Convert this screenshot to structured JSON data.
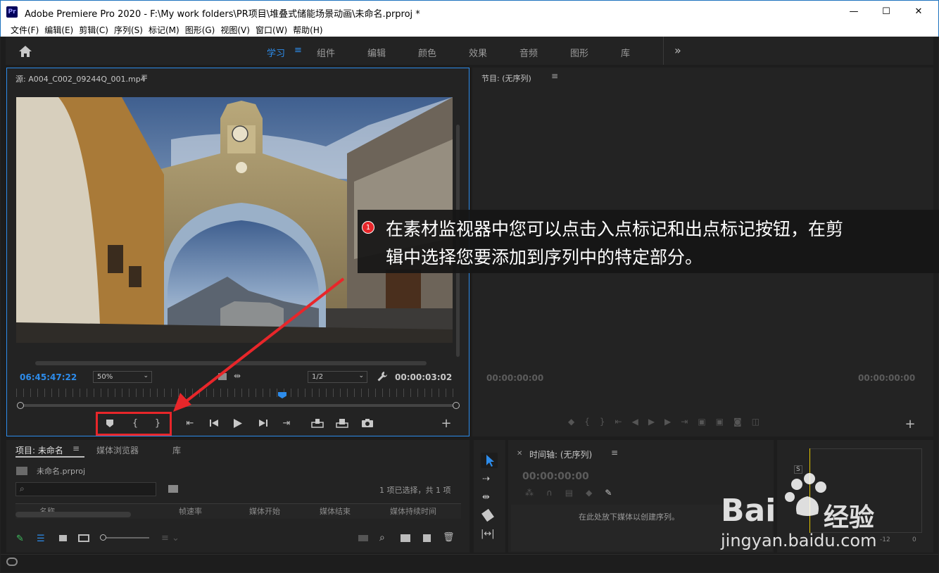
{
  "window": {
    "app_icon": "Pr",
    "title": "Adobe Premiere Pro 2020 - F:\\My work folders\\PR项目\\堆叠式储能场景动画\\未命名.prproj *",
    "min": "—",
    "max": "☐",
    "close": "✕"
  },
  "menu": [
    "文件(F)",
    "编辑(E)",
    "剪辑(C)",
    "序列(S)",
    "标记(M)",
    "图形(G)",
    "视图(V)",
    "窗口(W)",
    "帮助(H)"
  ],
  "workspaces": {
    "tabs": [
      "学习",
      "组件",
      "编辑",
      "颜色",
      "效果",
      "音频",
      "图形",
      "库"
    ],
    "active": "学习",
    "more": "»"
  },
  "source": {
    "title": "源: A004_C002_09244Q_001.mp4",
    "timecode": "06:45:47:22",
    "zoom": "50%",
    "resolution": "1/2",
    "duration": "00:00:03:02",
    "playhead_fraction": 0.6
  },
  "program": {
    "title": "节目: (无序列)",
    "timecode_left": "00:00:00:00",
    "timecode_right": "00:00:00:00"
  },
  "project": {
    "tabs": [
      "项目: 未命名",
      "媒体浏览器",
      "库"
    ],
    "file": "未命名.prproj",
    "selection": "1 项已选择，共 1 项",
    "columns": [
      "名称",
      "帧速率",
      "媒体开始",
      "媒体结束",
      "媒体持续时间"
    ]
  },
  "timeline": {
    "title": "时间轴: (无序列)",
    "timecode": "00:00:00:00",
    "drop_hint": "在此处放下媒体以创建序列。"
  },
  "meter": {
    "s_label": "S",
    "scale_left": "-12",
    "scale_right": "0"
  },
  "callout": {
    "number": "1",
    "text_line1": "在素材监视器中您可以点击入点标记和出点标记按钮，在剪",
    "text_line2": "辑中选择您要添加到序列中的特定部分。"
  },
  "watermark": {
    "brand": "Bai",
    "brand2": "经验",
    "url": "jingyan.baidu.com"
  },
  "colors": {
    "accent": "#2d8ceb",
    "highlight_box": "#e8262a",
    "callout_bg": "#1a1a1a"
  }
}
